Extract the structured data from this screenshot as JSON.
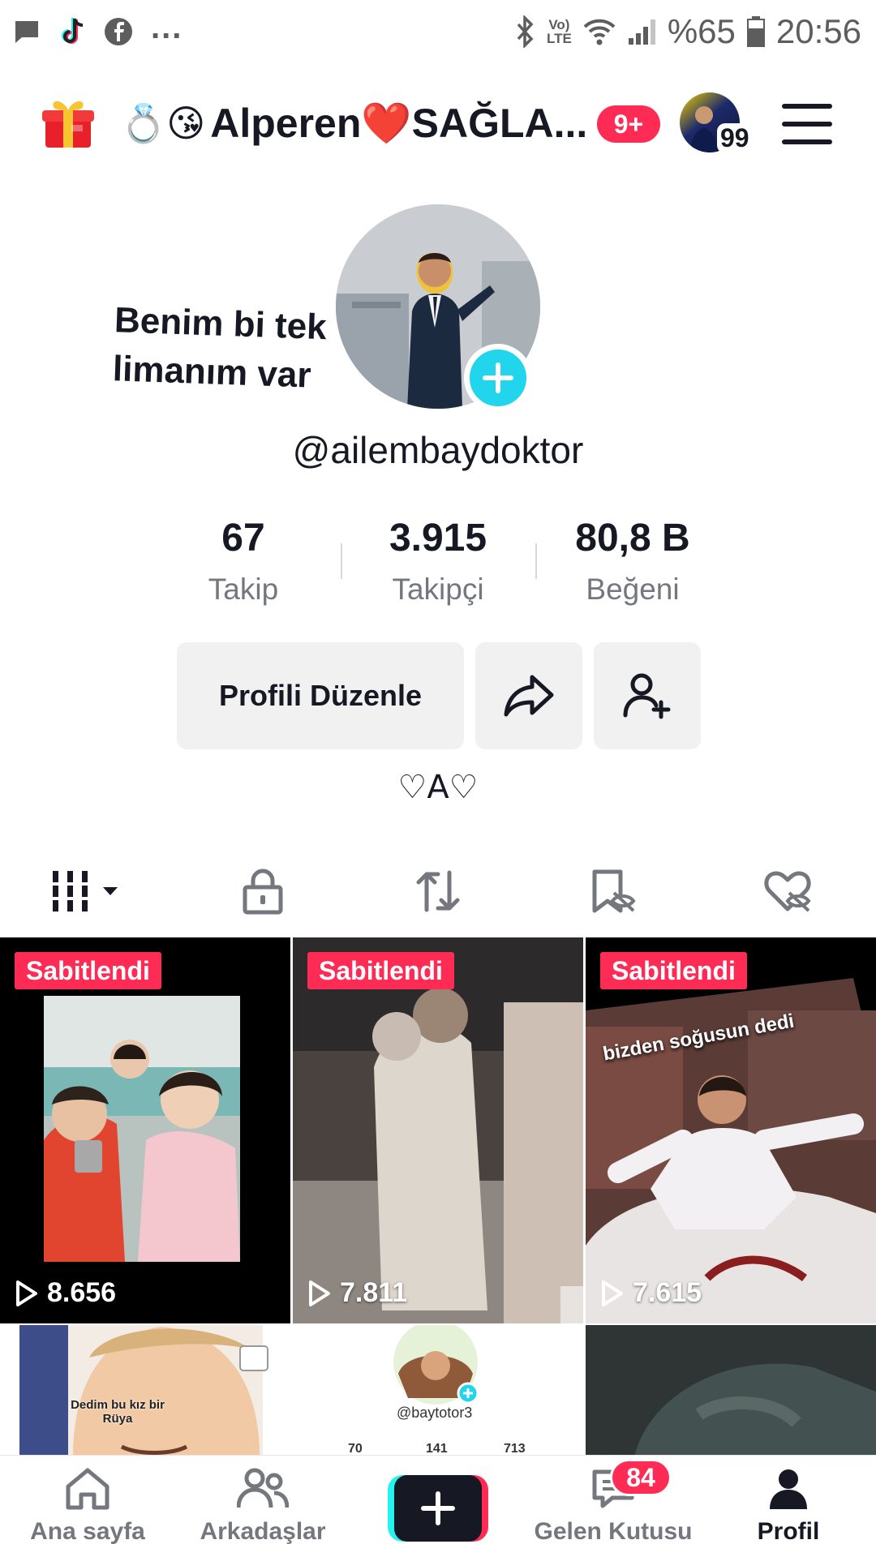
{
  "status_bar": {
    "battery": "%65",
    "time": "20:56",
    "lte_top": "Vo)",
    "lte_bottom": "LTE",
    "more": "..."
  },
  "header": {
    "title_emoji": "💍😘",
    "title": "Alperen❤️SAĞLA...",
    "notification_badge": "9+",
    "mini_avatar_count": "99"
  },
  "profile": {
    "caption_sticker": "Benim bi tek limanım var",
    "username": "@ailembaydoktor",
    "stats": [
      {
        "value": "67",
        "label": "Takip"
      },
      {
        "value": "3.915",
        "label": "Takipçi"
      },
      {
        "value": "80,8 B",
        "label": "Beğeni"
      }
    ],
    "edit_button": "Profili Düzenle",
    "bio": "♡A♡"
  },
  "tabs": [
    {
      "icon": "grid-videos-icon",
      "active": true
    },
    {
      "icon": "lock-icon",
      "active": false
    },
    {
      "icon": "repost-icon",
      "active": false
    },
    {
      "icon": "bookmark-hidden-icon",
      "active": false
    },
    {
      "icon": "liked-hidden-icon",
      "active": false
    }
  ],
  "videos": [
    {
      "pinned_label": "Sabitlendi",
      "views": "8.656"
    },
    {
      "pinned_label": "Sabitlendi",
      "views": "7.811"
    },
    {
      "pinned_label": "Sabitlendi",
      "views": "7.615",
      "caption": "bizden soğusun dedi"
    },
    {
      "caption": "Dedim bu kız bir Rüya"
    },
    {
      "handle": "@baytotor3",
      "mini_stats": [
        "70",
        "141",
        "713"
      ]
    },
    {}
  ],
  "bottom_nav": {
    "home": "Ana sayfa",
    "friends": "Arkadaşlar",
    "inbox": "Gelen Kutusu",
    "inbox_badge": "84",
    "profile": "Profil"
  },
  "colors": {
    "accent_red": "#fe2c55",
    "accent_cyan": "#20d5ec",
    "text_primary": "#161823",
    "text_secondary": "#75777e"
  }
}
